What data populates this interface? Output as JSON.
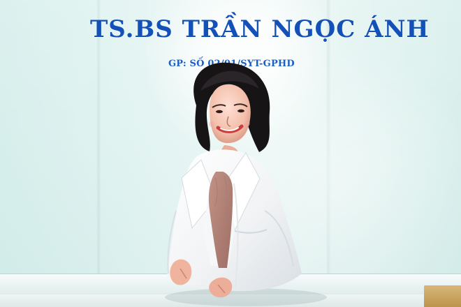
{
  "photo": {
    "sign_title": "TS.BS TRẦN NGỌC ÁNH",
    "license_text": "GP: SỐ 02/01/SYT-GPHD"
  },
  "colors": {
    "sign_blue": "#1350b7",
    "wall": "#e8f6f4",
    "coat": "#f7f8fa",
    "inner_top": "#b9857a",
    "hair": "#1a1718"
  },
  "icons": {
    "desk": "wood-desk-corner"
  }
}
